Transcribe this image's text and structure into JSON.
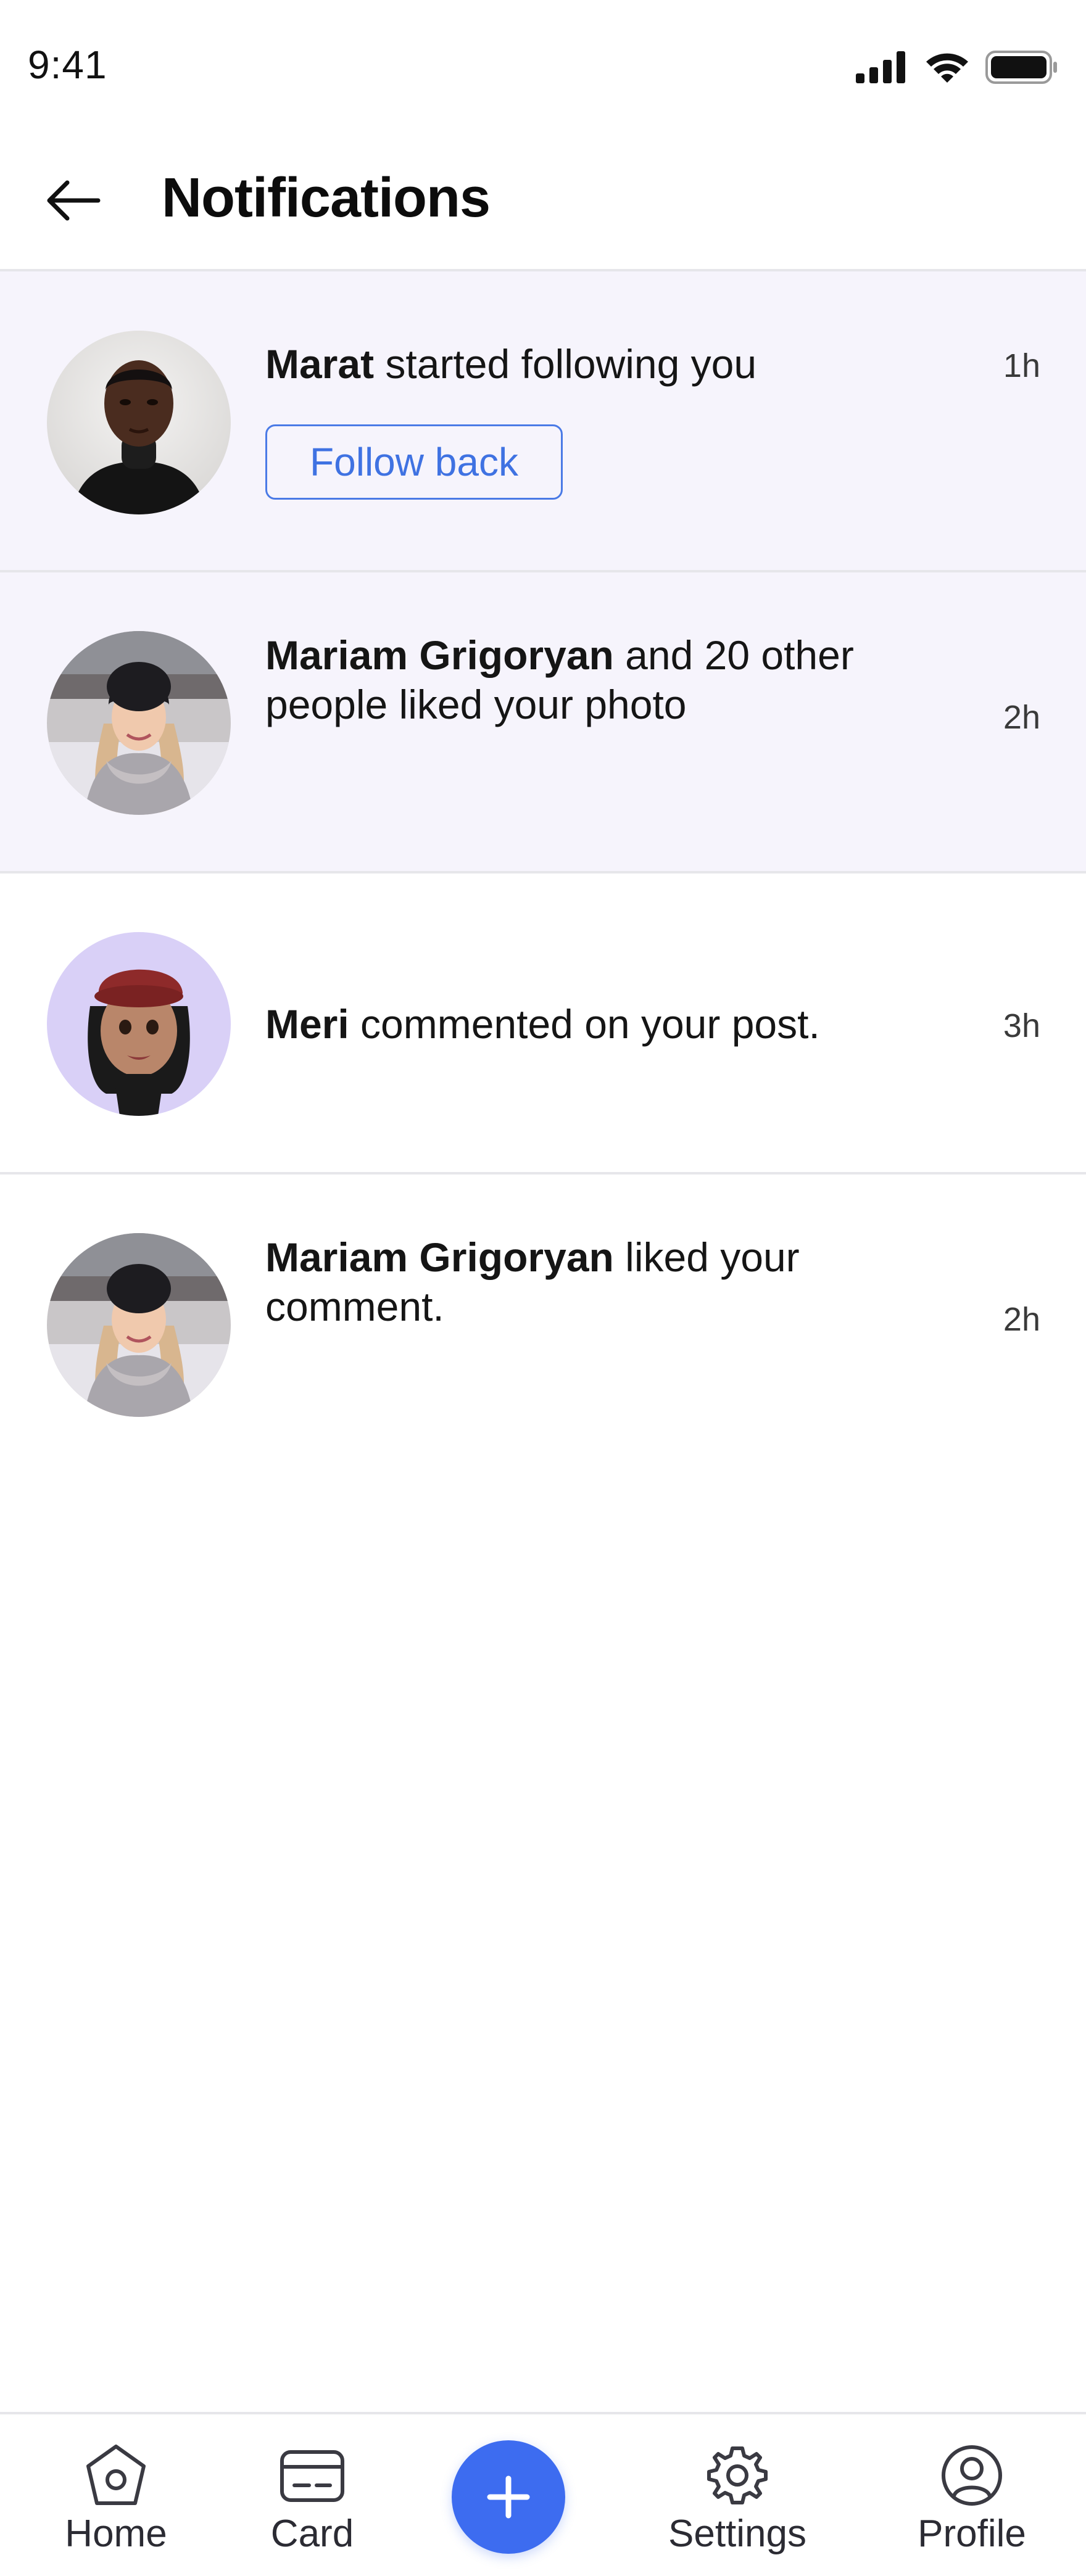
{
  "status_bar": {
    "time": "9:41",
    "icons": [
      "cellular-signal-icon",
      "wifi-icon",
      "battery-icon"
    ]
  },
  "header": {
    "back_icon": "arrow-left-icon",
    "title": "Notifications"
  },
  "notifications": [
    {
      "name": "Marat",
      "text": " started following you",
      "time": "1h",
      "action_label": "Follow back",
      "unread": true,
      "avatar": "man-portrait-photo"
    },
    {
      "name": "Mariam Grigoryan",
      "text": " and 20 other people liked your photo",
      "time": "2h",
      "unread": true,
      "avatar": "woman-winter-photo"
    },
    {
      "name": "Meri",
      "text": " commented on your post.",
      "time": "3h",
      "unread": false,
      "avatar": "memoji-beret-avatar"
    },
    {
      "name": "Mariam Grigoryan",
      "text": " liked your comment.",
      "time": "2h",
      "unread": false,
      "avatar": "woman-winter-photo"
    }
  ],
  "bottom_nav": {
    "items": [
      {
        "label": "Home",
        "icon": "home-icon"
      },
      {
        "label": "Card",
        "icon": "card-icon"
      },
      {
        "label": "Settings",
        "icon": "gear-icon"
      },
      {
        "label": "Profile",
        "icon": "user-circle-icon"
      }
    ],
    "add_icon": "plus-icon"
  },
  "colors": {
    "accent": "#3d6cf0",
    "follow_button": "#3f72e2",
    "unread_background": "#f6f4fc",
    "divider": "#e6e6ea",
    "meri_avatar_background": "#d9d0f7"
  }
}
